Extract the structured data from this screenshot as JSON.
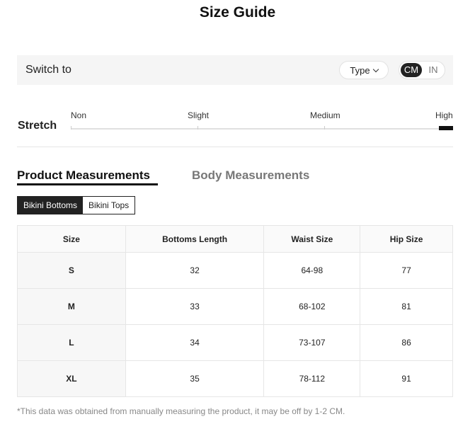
{
  "title": "Size Guide",
  "switch_bar": {
    "label": "Switch to",
    "type_button": "Type",
    "units": {
      "cm": "CM",
      "in": "IN",
      "selected": "CM"
    }
  },
  "stretch": {
    "label": "Stretch",
    "levels": [
      "Non",
      "Slight",
      "Medium",
      "High"
    ],
    "selected": "High"
  },
  "tabs": {
    "product": "Product Measurements",
    "body": "Body Measurements",
    "active": "Product Measurements"
  },
  "sub_tabs": {
    "bottoms": "Bikini Bottoms",
    "tops": "Bikini Tops",
    "active": "Bikini Bottoms"
  },
  "table": {
    "headers": [
      "Size",
      "Bottoms Length",
      "Waist Size",
      "Hip Size"
    ],
    "rows": [
      [
        "S",
        "32",
        "64-98",
        "77"
      ],
      [
        "M",
        "33",
        "68-102",
        "81"
      ],
      [
        "L",
        "34",
        "73-107",
        "86"
      ],
      [
        "XL",
        "35",
        "78-112",
        "91"
      ]
    ]
  },
  "footnote": "*This data was obtained from manually measuring the product, it may be off by 1-2 CM."
}
